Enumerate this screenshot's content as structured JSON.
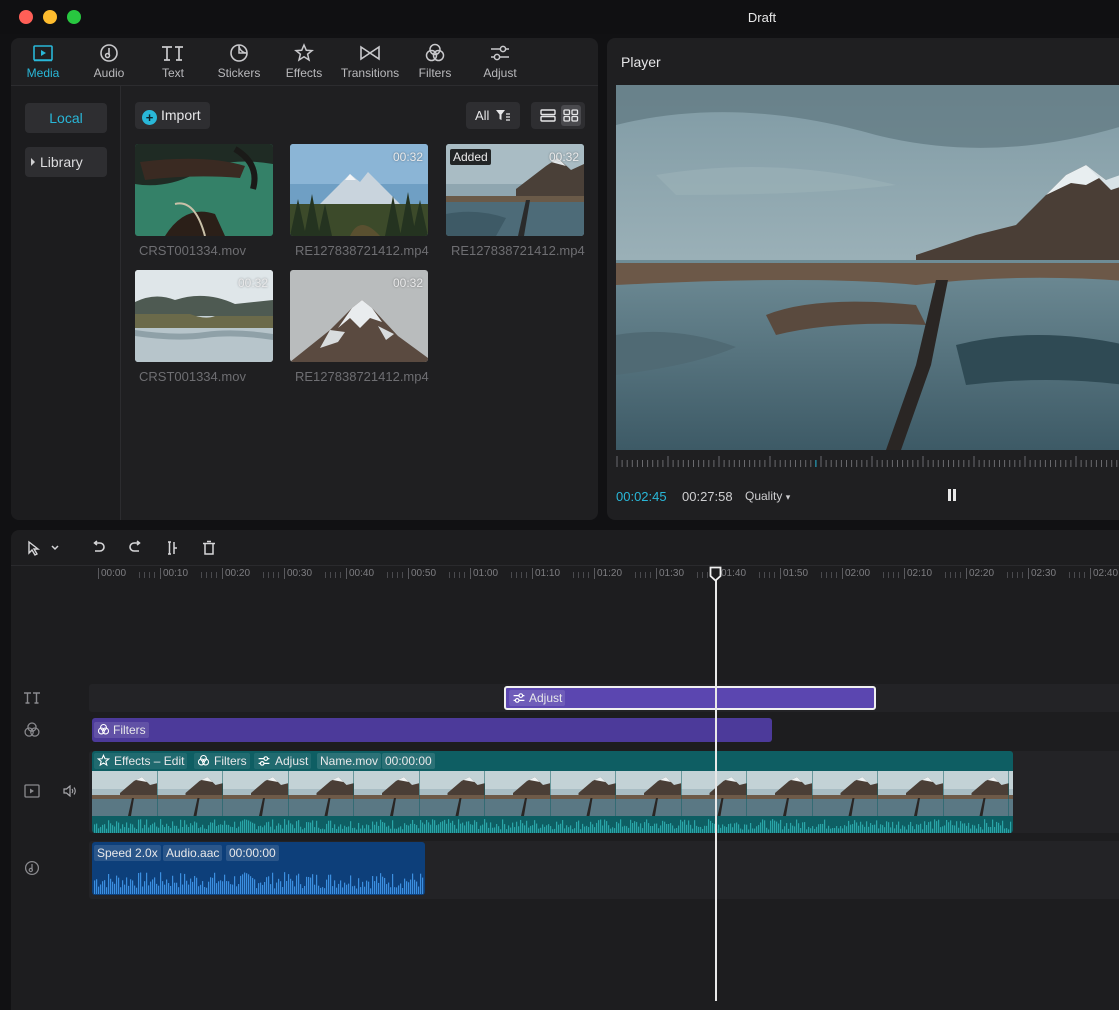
{
  "window": {
    "title": "Draft"
  },
  "colors": {
    "accent": "#29b7d8",
    "adjust_clip": "#5b46b0",
    "filters_clip": "#4c3a9a",
    "video_clip": "#0e5e63",
    "audio_clip": "#0d3f7a"
  },
  "toolbar": {
    "media": "Media",
    "audio": "Audio",
    "text": "Text",
    "stickers": "Stickers",
    "effects": "Effects",
    "transitions": "Transitions",
    "filters": "Filters",
    "adjust": "Adjust"
  },
  "sidebar": {
    "local": "Local",
    "library": "Library"
  },
  "media": {
    "import_label": "Import",
    "filter_label": "All",
    "items": [
      {
        "name": "CRST001334.mov",
        "duration": "",
        "added": ""
      },
      {
        "name": "RE127838721412.mp4",
        "duration": "00:32",
        "added": ""
      },
      {
        "name": "RE127838721412.mp4",
        "duration": "00:32",
        "added": "Added"
      },
      {
        "name": "CRST001334.mov",
        "duration": "00:32",
        "added": ""
      },
      {
        "name": "RE127838721412.mp4",
        "duration": "00:32",
        "added": ""
      }
    ]
  },
  "player": {
    "title": "Player",
    "current_time": "00:02:45",
    "total_time": "00:27:58",
    "quality": "Quality"
  },
  "timeline": {
    "ruler": [
      "00:00",
      "00:10",
      "00:20",
      "00:30",
      "00:40",
      "00:50",
      "01:00",
      "01:10",
      "01:20",
      "01:30",
      "01:40",
      "01:50",
      "02:00",
      "02:10",
      "02:20",
      "02:30",
      "02:40"
    ],
    "adjust_clip": "Adjust",
    "filters_clip": "Filters",
    "video_tags": {
      "effects": "Effects – Edit",
      "filters": "Filters",
      "adjust": "Adjust",
      "name": "Name.mov",
      "time": "00:00:00"
    },
    "audio_tags": {
      "speed": "Speed 2.0x",
      "name": "Audio.aac",
      "time": "00:00:00"
    }
  }
}
